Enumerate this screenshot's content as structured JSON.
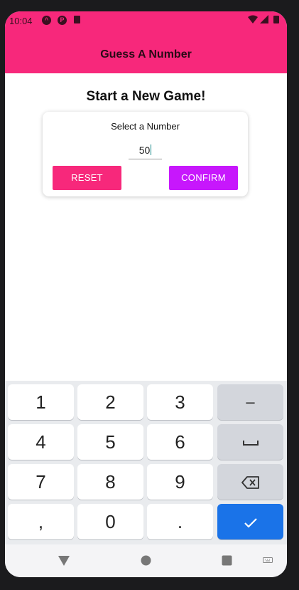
{
  "status_bar": {
    "time": "10:04",
    "icons": [
      "android-notification-icon",
      "p-notification-icon",
      "sd-card-icon",
      "wifi-icon",
      "signal-icon",
      "battery-icon"
    ]
  },
  "header": {
    "title": "Guess A Number"
  },
  "screen": {
    "title": "Start a New Game!"
  },
  "card": {
    "label": "Select a Number",
    "input_value": "50",
    "reset_label": "RESET",
    "confirm_label": "CONFIRM"
  },
  "keyboard": {
    "keys": [
      [
        "1",
        "2",
        "3",
        "–"
      ],
      [
        "4",
        "5",
        "6",
        "space"
      ],
      [
        "7",
        "8",
        "9",
        "backspace"
      ],
      [
        ",",
        "0",
        ".",
        "done"
      ]
    ]
  },
  "colors": {
    "primary": "#f7287b",
    "accent": "#c717fc",
    "keyboard_done": "#1a73e8"
  }
}
